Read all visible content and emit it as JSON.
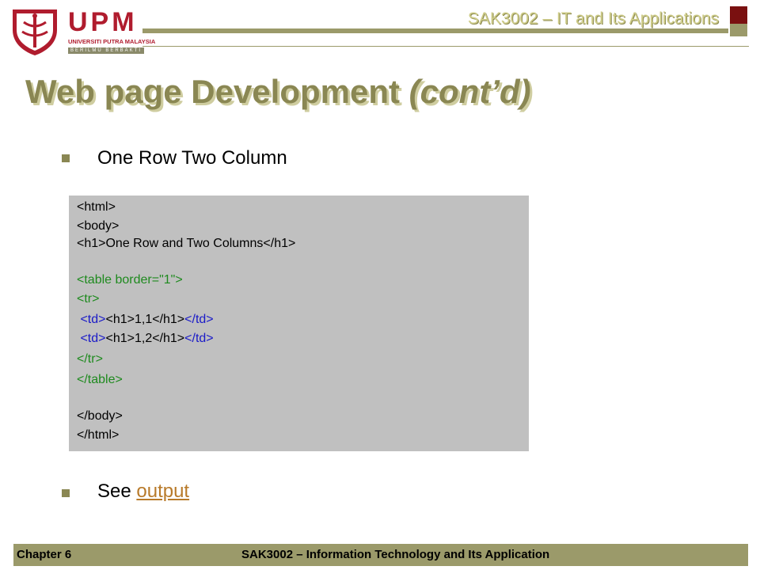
{
  "header": {
    "logo_text": "UPM",
    "logo_university": "UNIVERSITI PUTRA MALAYSIA",
    "logo_motto": "BERILMU BERBAKTI",
    "course_title": "SAK3002 – IT and Its Applications"
  },
  "slide": {
    "title_main": "Web page Development",
    "title_suffix": "(cont’d)",
    "bullet1": "One Row Two Column",
    "bullet2_prefix": "See ",
    "bullet2_link": "output"
  },
  "code": {
    "l1": "<html>",
    "l2": "<body>",
    "l3a": "<h1>",
    "l3b": "One Row and Two Columns",
    "l3c": "</h1>",
    "l4": "<table border=\"1\">",
    "l5": "<tr>",
    "l6a": " <td>",
    "l6b": "<h1>",
    "l6c": "1,1",
    "l6d": "</h1>",
    "l6e": "</td>",
    "l7a": " <td>",
    "l7b": "<h1>",
    "l7c": "1,2",
    "l7d": "</h1>",
    "l7e": "</td>",
    "l8": "</tr>",
    "l9": "</table>",
    "l10": "</body>",
    "l11": "</html>"
  },
  "footer": {
    "chapter": "Chapter 6",
    "course": "SAK3002 – Information Technology and Its Application"
  },
  "colors": {
    "accent": "#9b9a6a",
    "title": "#8a8753",
    "brand_red": "#b01c2e",
    "code_green": "#1e8a1e",
    "code_blue": "#1a1ac8",
    "link": "#b87a2a"
  }
}
